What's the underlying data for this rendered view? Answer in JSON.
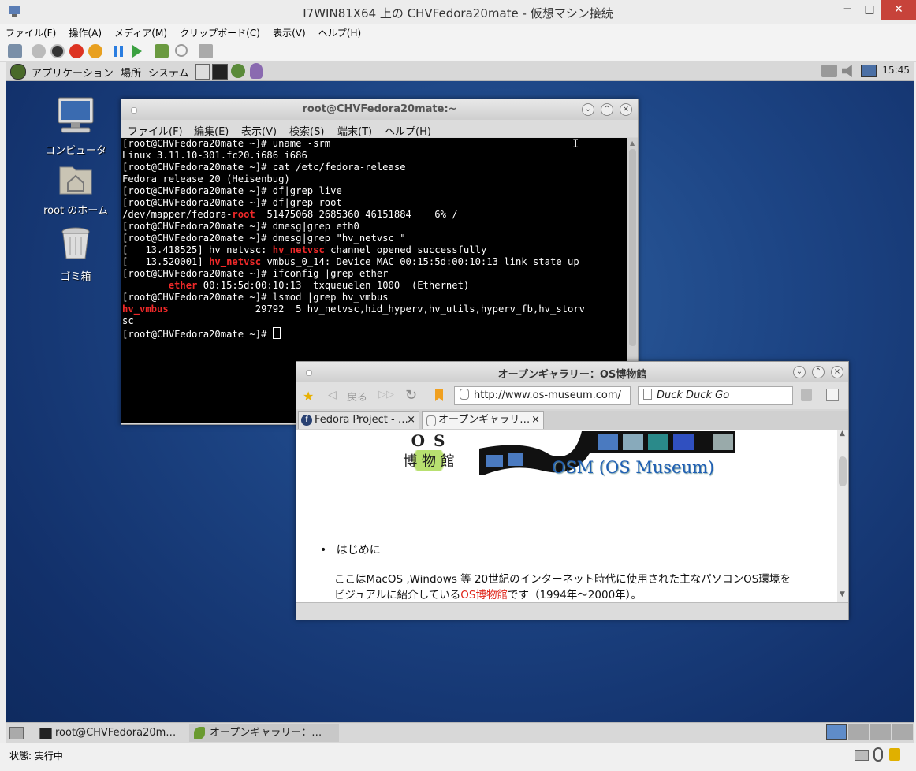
{
  "host": {
    "title": "I7WIN81X64 上の CHVFedora20mate - 仮想マシン接続",
    "menu": [
      "ファイル(F)",
      "操作(A)",
      "メディア(M)",
      "クリップボード(C)",
      "表示(V)",
      "ヘルプ(H)"
    ],
    "status": "状態: 実行中",
    "controls": {
      "minimize": "─",
      "maximize": "□",
      "close": "✕"
    }
  },
  "vm_panel": {
    "menu": [
      "アプリケーション",
      "場所",
      "システム"
    ],
    "clock": "15:45"
  },
  "desktop_icons": [
    {
      "label": "コンピュータ",
      "icon": "computer-icon"
    },
    {
      "label": "root のホーム",
      "icon": "home-folder-icon"
    },
    {
      "label": "ゴミ箱",
      "icon": "trash-icon"
    }
  ],
  "terminal": {
    "title": "root@CHVFedora20mate:~",
    "menu": [
      "ファイル(F)",
      "編集(E)",
      "表示(V)",
      "検索(S)",
      "端末(T)",
      "ヘルプ(H)"
    ],
    "lines": [
      "[root@CHVFedora20mate ~]# uname -srm",
      "Linux 3.11.10-301.fc20.i686 i686",
      "[root@CHVFedora20mate ~]# cat /etc/fedora-release",
      "Fedora release 20 (Heisenbug)",
      "[root@CHVFedora20mate ~]# df|grep live",
      "[root@CHVFedora20mate ~]# df|grep root",
      "/dev/mapper/fedora-root  51475068 2685360 46151884    6% /",
      "[root@CHVFedora20mate ~]# dmesg|grep eth0",
      "[root@CHVFedora20mate ~]# dmesg|grep \"hv_netvsc \"",
      "[   13.418525] hv_netvsc: hv_netvsc channel opened successfully",
      "[   13.520001] hv_netvsc vmbus_0_14: Device MAC 00:15:5d:00:10:13 link state up",
      "[root@CHVFedora20mate ~]# ifconfig |grep ether",
      "        ether 00:15:5d:00:10:13  txqueuelen 1000  (Ethernet)",
      "[root@CHVFedora20mate ~]# lsmod |grep hv_vmbus",
      "hv_vmbus               29792  5 hv_netvsc,hid_hyperv,hv_utils,hyperv_fb,hv_storv",
      "sc",
      "[root@CHVFedora20mate ~]# "
    ],
    "highlight": {
      "root": "root",
      "netvsc": "hv_netvsc",
      "ether": "ether",
      "vmbus": "hv_vmbus"
    }
  },
  "browser": {
    "title": "オープンギャラリー：OS博物館",
    "back_label": "戻る",
    "url": "http://www.os-museum.com/",
    "search_placeholder": "Duck Duck Go",
    "tabs": [
      {
        "label": "Fedora Project - …",
        "close": "×"
      },
      {
        "label": "オープンギャラリ…",
        "close": "×"
      }
    ],
    "logo_top": "O S",
    "logo_bottom": "博 物 館",
    "banner": "OSM (OS Museum)",
    "bullet": "はじめに",
    "paragraph_line1": "ここはMacOS ,Windows 等 20世紀のインターネット時代に使用された主なパソコンOS環境を",
    "paragraph_line2_pre": "ビジュアルに紹介している",
    "paragraph_link": "OS博物館",
    "paragraph_line2_post": "です（1994年～2000年）。"
  },
  "taskbar": {
    "items": [
      "root@CHVFedora20m…",
      "オープンギャラリー：…"
    ]
  },
  "colors": {
    "terminal_red": "#ef2929",
    "link_red": "#e0261b",
    "banner_blue": "#1f5fb3",
    "desktop": "#1d4585"
  }
}
